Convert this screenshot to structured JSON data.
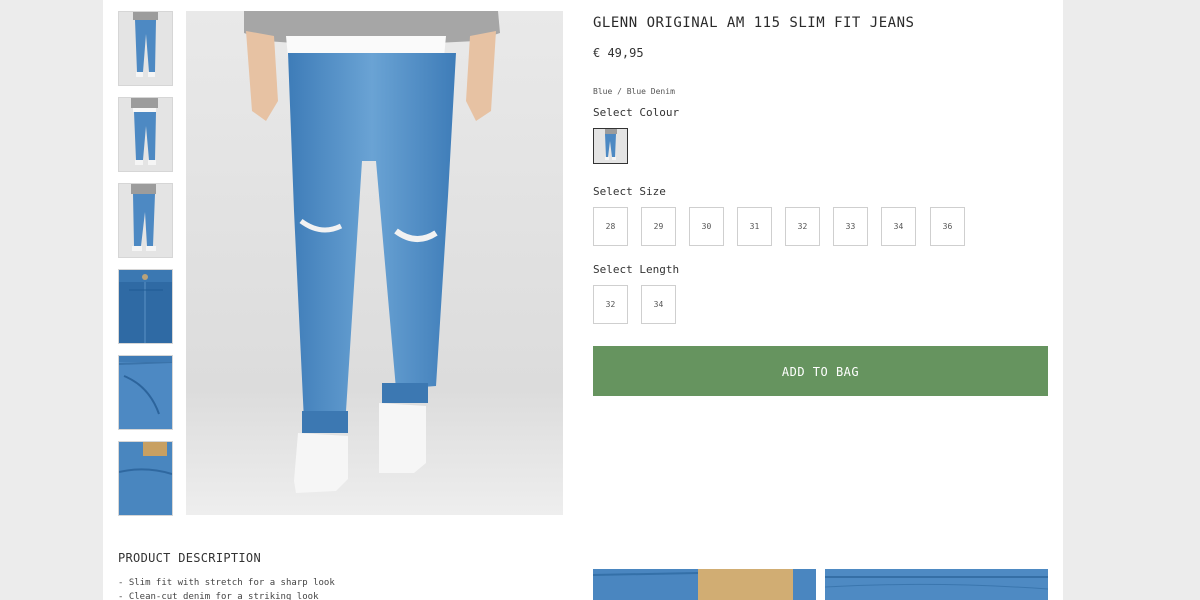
{
  "product": {
    "title": "GLENN ORIGINAL AM 115 SLIM FIT JEANS",
    "price": "€ 49,95",
    "variant": "Blue / Blue Denim",
    "colour_label": "Select Colour",
    "size_label": "Select Size",
    "length_label": "Select Length",
    "sizes": [
      "28",
      "29",
      "30",
      "31",
      "32",
      "33",
      "34",
      "36"
    ],
    "lengths": [
      "32",
      "34"
    ],
    "add_to_bag": "ADD TO BAG"
  },
  "gallery": {
    "thumbnails": [
      "front-full",
      "front-full",
      "side-full",
      "pocket-closeup",
      "front-pocket",
      "back-pocket"
    ]
  },
  "description": {
    "title": "PRODUCT DESCRIPTION",
    "items": [
      "- Slim fit with stretch for a sharp look",
      "- Clean-cut denim for a striking look"
    ]
  },
  "colors": {
    "accent": "#66945f",
    "denim": "#4a86c0"
  }
}
